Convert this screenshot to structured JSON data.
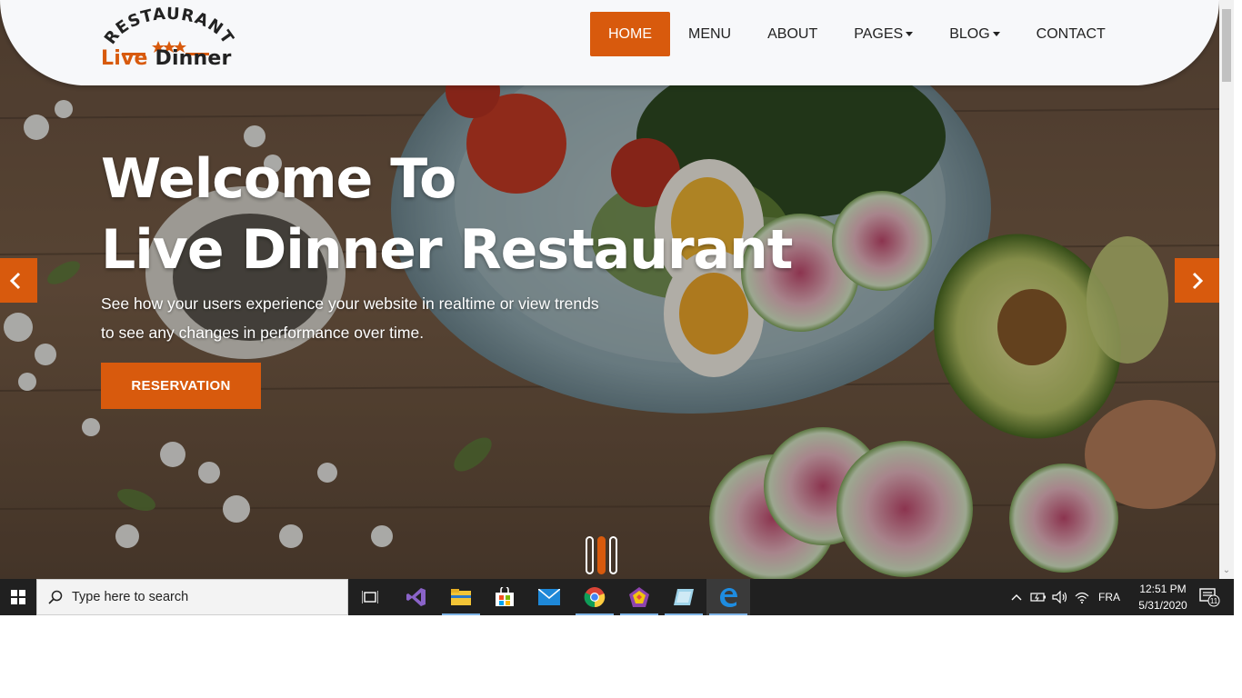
{
  "logo": {
    "arc_text": "RESTAURANT",
    "word_live": "Live",
    "word_dinner": "Dinner"
  },
  "nav": {
    "items": [
      {
        "label": "HOME",
        "active": true
      },
      {
        "label": "MENU"
      },
      {
        "label": "ABOUT"
      },
      {
        "label": "PAGES",
        "dropdown": true
      },
      {
        "label": "BLOG",
        "dropdown": true
      },
      {
        "label": "CONTACT"
      }
    ]
  },
  "hero": {
    "title_line1": "Welcome To",
    "title_line2": "Live Dinner Restaurant",
    "subtitle": "See how your users experience your website in realtime or view trends to see any changes in performance over time.",
    "button_label": "RESERVATION",
    "prev_icon": "chevron-left-icon",
    "next_icon": "chevron-right-icon",
    "slides_count": 3,
    "active_slide": 2
  },
  "colors": {
    "accent": "#d85a0d",
    "header_bg": "#f7f8fa",
    "taskbar_bg": "#202020"
  },
  "taskbar": {
    "search_placeholder": "Type here to search",
    "apps": [
      "task-view-icon",
      "visual-studio-icon",
      "file-explorer-icon",
      "store-icon",
      "mail-icon",
      "chrome-icon",
      "app-icon",
      "photos-icon",
      "edge-icon"
    ],
    "language": "FRA",
    "time": "12:51 PM",
    "date": "5/31/2020",
    "notification_count": "11"
  }
}
